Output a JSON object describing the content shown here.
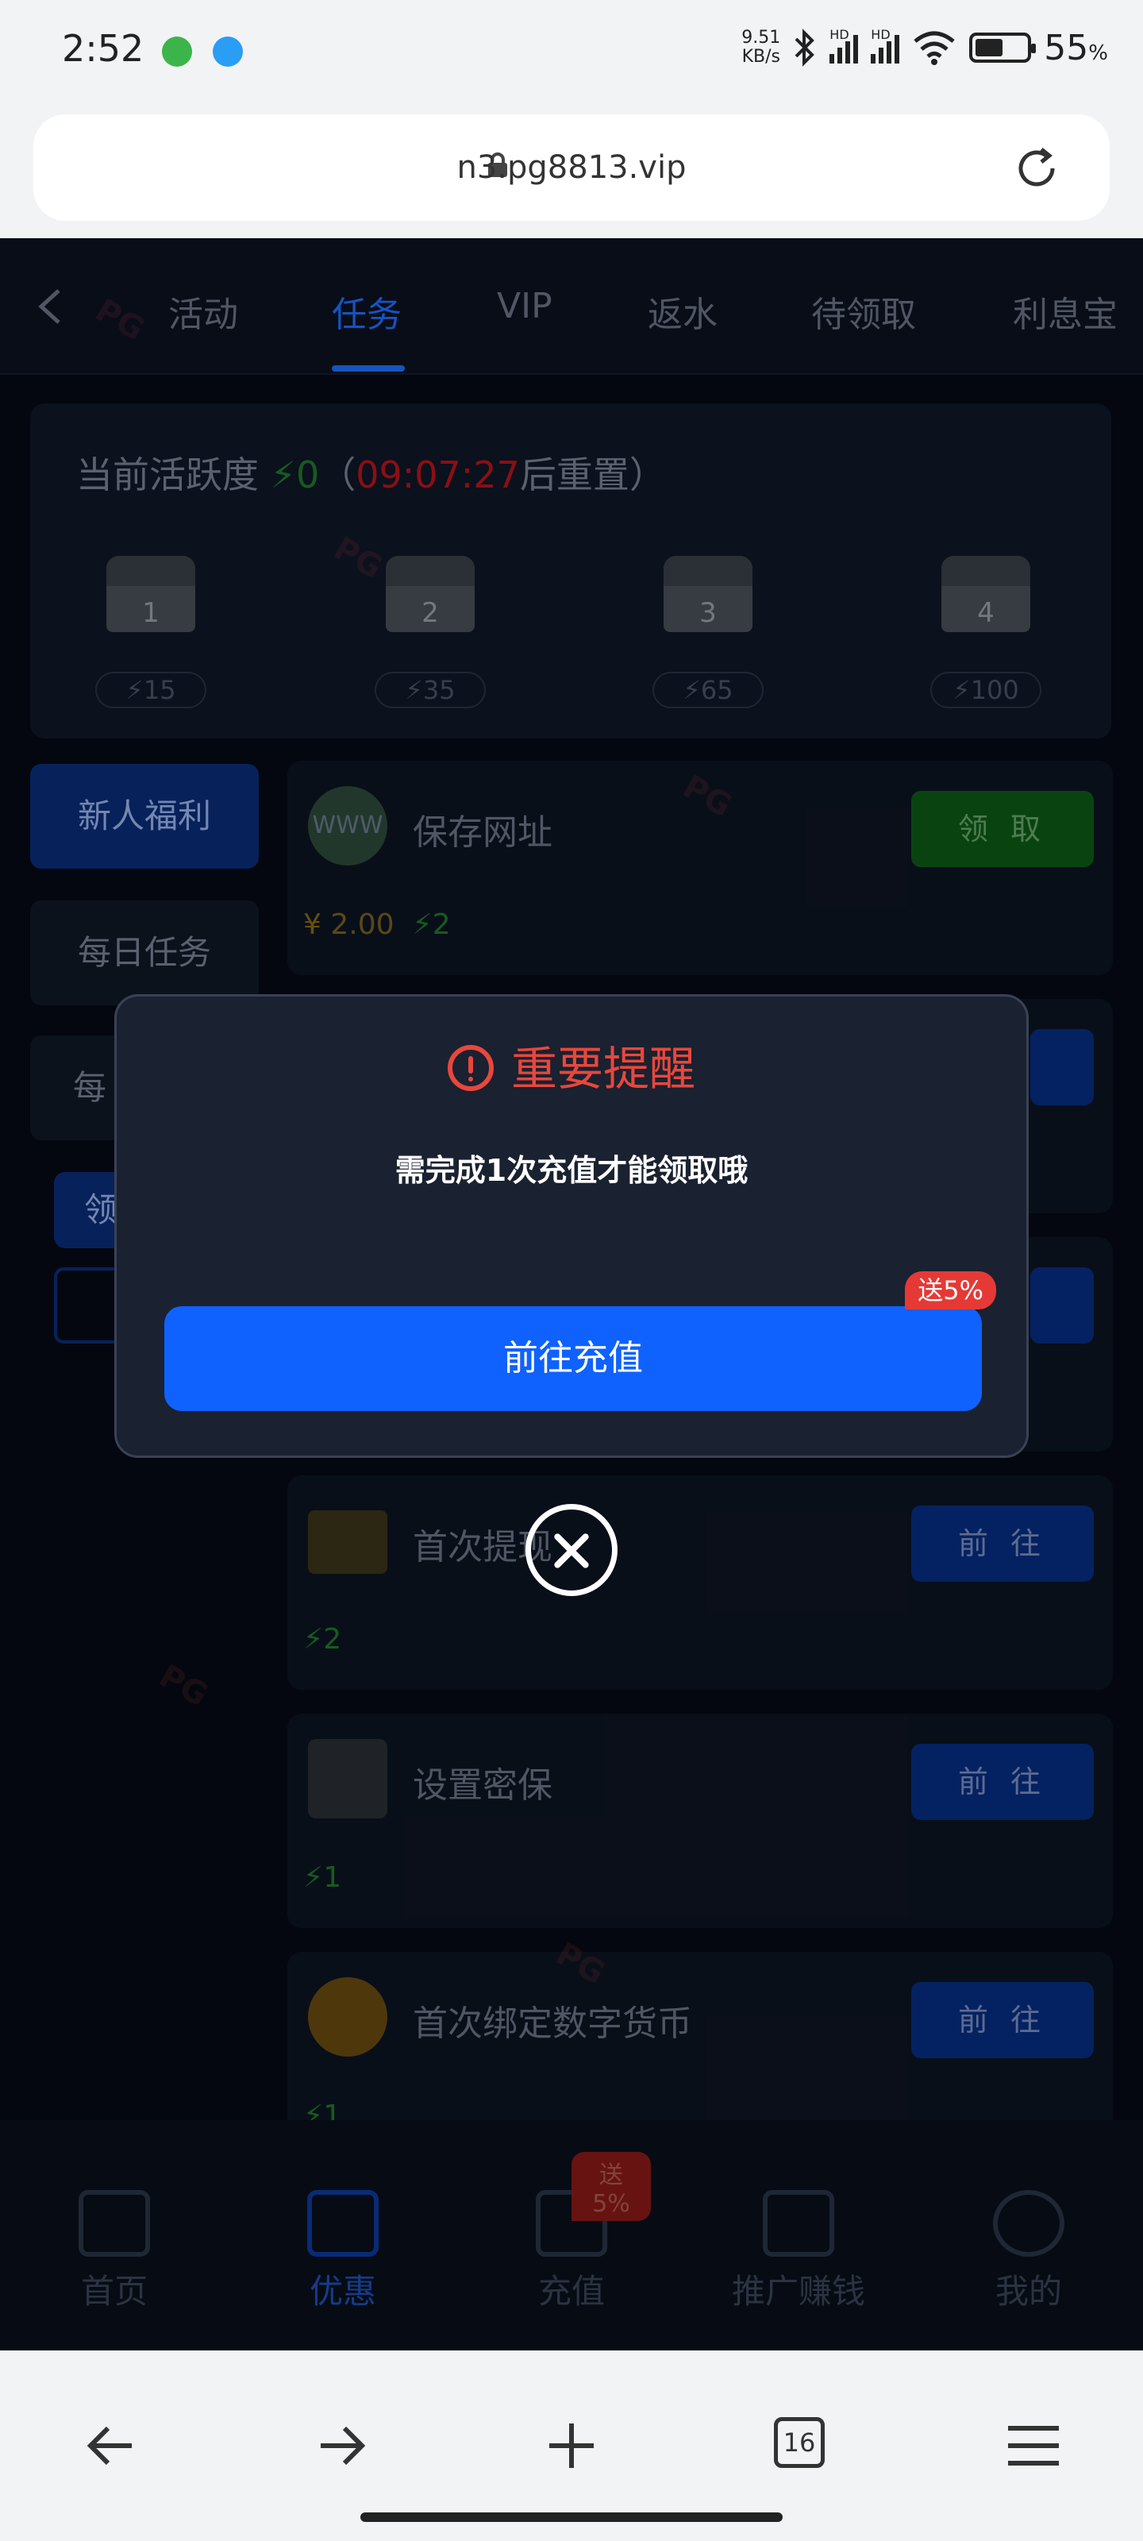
{
  "status_bar": {
    "time": "2:52",
    "net_speed": "9.51",
    "net_unit": "KB/s",
    "hd1": "HD",
    "hd2": "HD",
    "battery": "55",
    "battery_unit": "%"
  },
  "browser": {
    "url": "n3.pg8813.vip",
    "tab_count": "16"
  },
  "tabs": [
    "活动",
    "任务",
    "VIP",
    "返水",
    "待领取",
    "利息宝"
  ],
  "activity": {
    "title": "当前活跃度",
    "value": "0",
    "open_paren": "（",
    "timer": "09:07:27",
    "reset": "后重置）",
    "chests": [
      {
        "num": "1",
        "points": "15"
      },
      {
        "num": "2",
        "points": "35"
      },
      {
        "num": "3",
        "points": "65"
      },
      {
        "num": "4",
        "points": "100"
      }
    ]
  },
  "side_menu": [
    "新人福利",
    "每日任务",
    "每",
    "领"
  ],
  "tasks": [
    {
      "name": "保存网址",
      "coin": "2.00",
      "points": "2",
      "button": "领 取"
    },
    {
      "name": "首次提现",
      "points": "2",
      "button": "前 往"
    },
    {
      "name": "设置密保",
      "points": "1",
      "button": "前 往"
    },
    {
      "name": "首次绑定数字货币",
      "points": "1",
      "button": "前 往"
    }
  ],
  "task_icon_labels": {
    "www": "WWW"
  },
  "bottom_nav": [
    {
      "label": "首页"
    },
    {
      "label": "优惠"
    },
    {
      "label": "充值",
      "badge": "送5%"
    },
    {
      "label": "推广赚钱"
    },
    {
      "label": "我的"
    }
  ],
  "modal": {
    "title": "重要提醒",
    "message": "需完成1次充值才能领取哦",
    "button": "前往充值",
    "badge": "送5%"
  },
  "watermark": "PG"
}
